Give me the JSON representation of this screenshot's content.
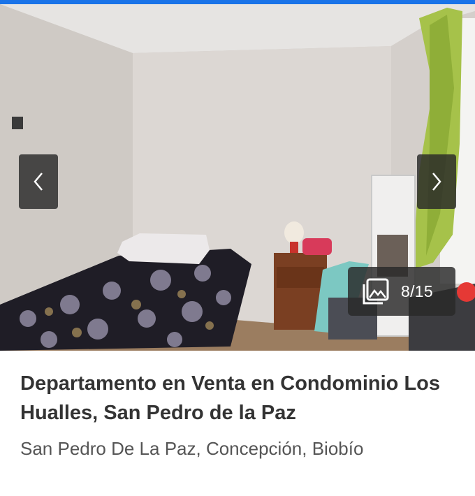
{
  "gallery": {
    "counter": "8/15",
    "prev_icon": "chevron-left-icon",
    "next_icon": "chevron-right-icon",
    "gallery_icon": "image-gallery-icon"
  },
  "listing": {
    "title": "Departamento en Venta en Condominio Los Hualles, San Pedro de la Paz",
    "location": "San Pedro De La Paz, Concepción, Biobío"
  },
  "colors": {
    "accent_bar": "#1a73e8",
    "title_text": "#333333",
    "location_text": "#555555",
    "overlay": "#282828"
  }
}
